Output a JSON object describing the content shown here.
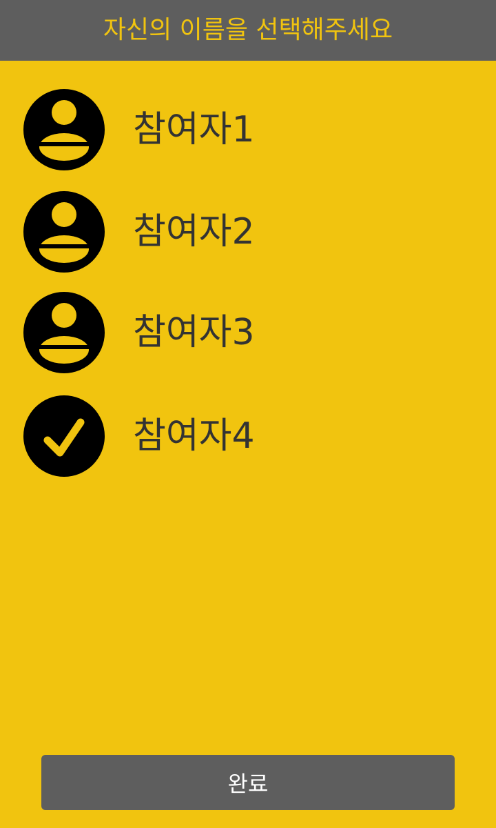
{
  "header": {
    "title": "자신의 이름을 선택해주세요"
  },
  "colors": {
    "background": "#F1C40F",
    "header_bg": "#5E5E5E",
    "header_text": "#F1C40F",
    "item_text": "#333333",
    "icon_fill": "#000000",
    "button_bg": "#5E5E5E",
    "button_text": "#FFFFFF"
  },
  "participants": [
    {
      "name": "참여자1",
      "icon": "user-avatar-icon",
      "selected": false
    },
    {
      "name": "참여자2",
      "icon": "user-avatar-icon",
      "selected": false
    },
    {
      "name": "참여자3",
      "icon": "user-avatar-icon",
      "selected": false
    },
    {
      "name": "참여자4",
      "icon": "checkmark-icon",
      "selected": true
    }
  ],
  "footer": {
    "done_label": "완료"
  }
}
